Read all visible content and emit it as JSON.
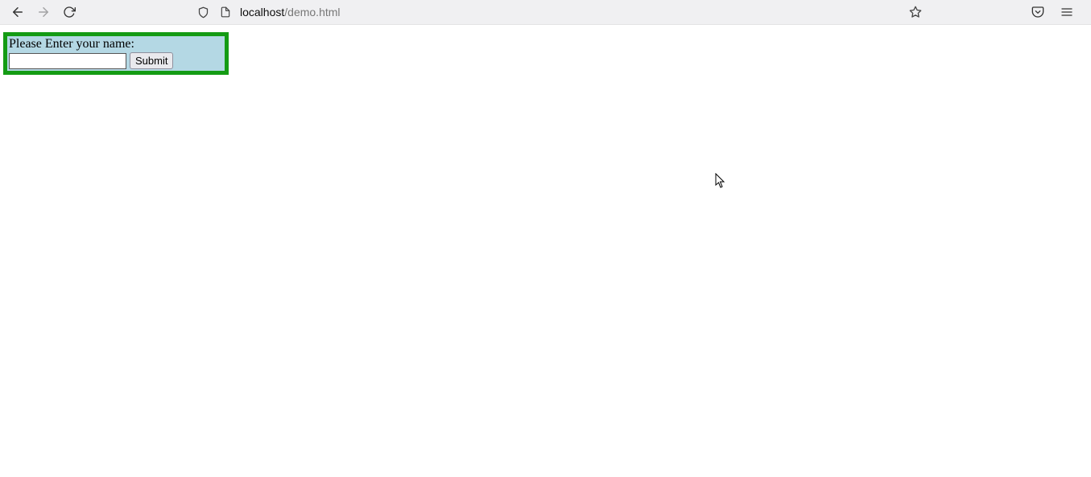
{
  "browser": {
    "url_host": "localhost",
    "url_path": "/demo.html"
  },
  "form": {
    "label": "Please Enter your name:",
    "name_value": "",
    "submit_label": "Submit"
  }
}
